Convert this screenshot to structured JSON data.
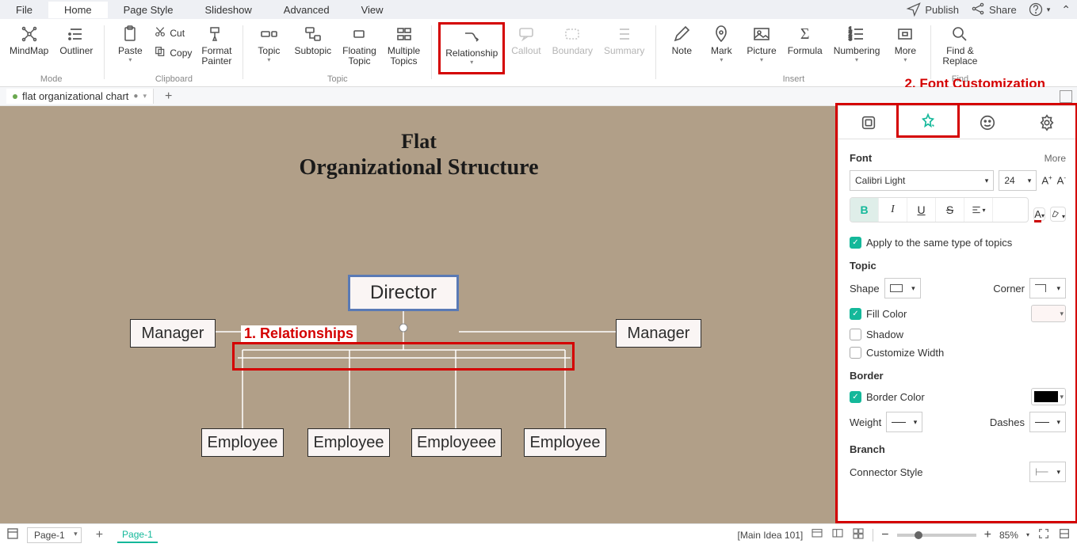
{
  "menu": {
    "file": "File",
    "home": "Home",
    "pagestyle": "Page Style",
    "slideshow": "Slideshow",
    "advanced": "Advanced",
    "view": "View",
    "publish": "Publish",
    "share": "Share"
  },
  "ribbon": {
    "mindmap": "MindMap",
    "outliner": "Outliner",
    "mode": "Mode",
    "paste": "Paste",
    "cut": "Cut",
    "copy": "Copy",
    "format_painter": "Format\nPainter",
    "clipboard": "Clipboard",
    "topic": "Topic",
    "subtopic": "Subtopic",
    "floating_topic": "Floating\nTopic",
    "multiple_topics": "Multiple\nTopics",
    "topic_group": "Topic",
    "relationship": "Relationship",
    "callout": "Callout",
    "boundary": "Boundary",
    "summary": "Summary",
    "note": "Note",
    "mark": "Mark",
    "picture": "Picture",
    "formula": "Formula",
    "numbering": "Numbering",
    "more": "More",
    "insert": "Insert",
    "find_replace": "Find &\nReplace",
    "find": "Find"
  },
  "doc": {
    "name": "flat organizational chart"
  },
  "canvas": {
    "title1": "Flat",
    "title2": "Organizational Structure",
    "director": "Director",
    "manager": "Manager",
    "employee": "Employee",
    "employeee": "Employeee"
  },
  "annotations": {
    "relationships": "1. Relationships",
    "fontcustom": "2. Font Customization"
  },
  "panel": {
    "font_header": "Font",
    "more": "More",
    "font_family": "Calibri Light",
    "font_size": "24",
    "apply_same": "Apply to the same type of topics",
    "topic_header": "Topic",
    "shape": "Shape",
    "corner": "Corner",
    "fill_color": "Fill Color",
    "shadow": "Shadow",
    "customize_width": "Customize Width",
    "border_header": "Border",
    "border_color": "Border Color",
    "weight": "Weight",
    "dashes": "Dashes",
    "branch_header": "Branch",
    "connector_style": "Connector Style"
  },
  "footer": {
    "page_dropdown": "Page-1",
    "page_tab": "Page-1",
    "status": "[Main Idea 101]",
    "zoom": "85%"
  }
}
